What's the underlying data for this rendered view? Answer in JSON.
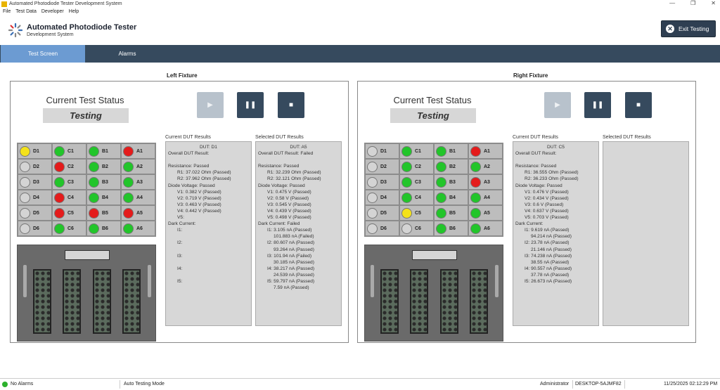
{
  "window": {
    "title": "Automated Photodiode Tester Development System",
    "controls": [
      "—",
      "❐",
      "✕"
    ]
  },
  "menu": [
    "File",
    "Test Data",
    "Developer",
    "Help"
  ],
  "header": {
    "title": "Automated Photodiode Tester",
    "subtitle": "Development System",
    "exit_label": "Exit Testing",
    "exit_icon": "close-circle-icon"
  },
  "tabs": [
    {
      "label": "Test Screen",
      "active": true
    },
    {
      "label": "Alarms",
      "active": false
    }
  ],
  "colors": {
    "green": "#22c52a",
    "red": "#e41b1b",
    "yellow": "#f4e21a",
    "grey": "#d4d4d4",
    "nav": "#364a5e",
    "tab_active": "#6c9bd2"
  },
  "fixtures": [
    {
      "title": "Left Fixture",
      "status_heading": "Current Test Status",
      "status": "Testing",
      "controls": {
        "play": "▶",
        "pause": "❚❚",
        "stop": "■"
      },
      "grid": [
        [
          {
            "label": "D1",
            "state": "yellow"
          },
          {
            "label": "C1",
            "state": "green"
          },
          {
            "label": "B1",
            "state": "green"
          },
          {
            "label": "A1",
            "state": "red"
          }
        ],
        [
          {
            "label": "D2",
            "state": "grey"
          },
          {
            "label": "C2",
            "state": "red"
          },
          {
            "label": "B2",
            "state": "green"
          },
          {
            "label": "A2",
            "state": "green"
          }
        ],
        [
          {
            "label": "D3",
            "state": "grey"
          },
          {
            "label": "C3",
            "state": "green"
          },
          {
            "label": "B3",
            "state": "green"
          },
          {
            "label": "A3",
            "state": "green"
          }
        ],
        [
          {
            "label": "D4",
            "state": "grey"
          },
          {
            "label": "C4",
            "state": "red"
          },
          {
            "label": "B4",
            "state": "green"
          },
          {
            "label": "A4",
            "state": "green"
          }
        ],
        [
          {
            "label": "D5",
            "state": "grey"
          },
          {
            "label": "C5",
            "state": "red"
          },
          {
            "label": "B5",
            "state": "red"
          },
          {
            "label": "A5",
            "state": "red"
          }
        ],
        [
          {
            "label": "D6",
            "state": "grey"
          },
          {
            "label": "C6",
            "state": "green"
          },
          {
            "label": "B6",
            "state": "green"
          },
          {
            "label": "A6",
            "state": "green"
          }
        ]
      ],
      "current_label": "Current DUT Results",
      "current_results": [
        {
          "text": "DUT: D1",
          "style": "c"
        },
        {
          "text": "Overall DUT Result:",
          "style": ""
        },
        {
          "text": "",
          "style": ""
        },
        {
          "text": "Resistance: Passed",
          "style": ""
        },
        {
          "text": "R1: 37.022 Ohm (Passed)",
          "style": "i1"
        },
        {
          "text": "R2: 37.962 Ohm (Passed)",
          "style": "i1"
        },
        {
          "text": "Diode Voltage: Passed",
          "style": ""
        },
        {
          "text": "V1: 0.382 V (Passed)",
          "style": "i1"
        },
        {
          "text": "V2: 0.719 V (Passed)",
          "style": "i1"
        },
        {
          "text": "V3: 0.463 V (Passed)",
          "style": "i1"
        },
        {
          "text": "V4: 0.442 V (Passed)",
          "style": "i1"
        },
        {
          "text": "V5:",
          "style": "i1"
        },
        {
          "text": "Dark Current:",
          "style": ""
        },
        {
          "text": "I1:",
          "style": "i1"
        },
        {
          "text": "",
          "style": ""
        },
        {
          "text": "I2:",
          "style": "i1"
        },
        {
          "text": "",
          "style": ""
        },
        {
          "text": "I3:",
          "style": "i1"
        },
        {
          "text": "",
          "style": ""
        },
        {
          "text": "I4:",
          "style": "i1"
        },
        {
          "text": "",
          "style": ""
        },
        {
          "text": "I5:",
          "style": "i1"
        }
      ],
      "selected_label": "Selected DUT Results",
      "selected_results": [
        {
          "text": "DUT: A5",
          "style": "c"
        },
        {
          "text": "Overall DUT Result: Failed",
          "style": ""
        },
        {
          "text": "",
          "style": ""
        },
        {
          "text": "Resistance: Passed",
          "style": ""
        },
        {
          "text": "R1: 32.239 Ohm (Passed)",
          "style": "i1"
        },
        {
          "text": "R2: 32.121 Ohm (Passed)",
          "style": "i1"
        },
        {
          "text": "Diode Voltage: Passed",
          "style": ""
        },
        {
          "text": "V1: 0.475 V (Passed)",
          "style": "i1"
        },
        {
          "text": "V2: 0.58 V (Passed)",
          "style": "i1"
        },
        {
          "text": "V3: 0.545 V (Passed)",
          "style": "i1"
        },
        {
          "text": "V4: 0.439 V (Passed)",
          "style": "i1"
        },
        {
          "text": "V5: 0.498 V (Passed)",
          "style": "i1"
        },
        {
          "text": "Dark Current: Failed",
          "style": ""
        },
        {
          "text": "I1: 3.105 nA (Passed)",
          "style": "i1"
        },
        {
          "text": "101.883 nA (Failed)",
          "style": "i2"
        },
        {
          "text": "I2: 80.607 nA (Passed)",
          "style": "i1"
        },
        {
          "text": "93.264 nA (Passed)",
          "style": "i2"
        },
        {
          "text": "I3: 101.94 nA (Failed)",
          "style": "i1"
        },
        {
          "text": "30.185 nA (Passed)",
          "style": "i2"
        },
        {
          "text": "I4: 38.217 nA (Passed)",
          "style": "i1"
        },
        {
          "text": "24.539 nA (Passed)",
          "style": "i2"
        },
        {
          "text": "I5: 59.797 nA (Passed)",
          "style": "i1"
        },
        {
          "text": "7.59 nA (Passed)",
          "style": "i2"
        }
      ]
    },
    {
      "title": "Right Fixture",
      "status_heading": "Current Test Status",
      "status": "Testing",
      "controls": {
        "play": "▶",
        "pause": "❚❚",
        "stop": "■"
      },
      "grid": [
        [
          {
            "label": "D1",
            "state": "grey"
          },
          {
            "label": "C1",
            "state": "green"
          },
          {
            "label": "B1",
            "state": "green"
          },
          {
            "label": "A1",
            "state": "red"
          }
        ],
        [
          {
            "label": "D2",
            "state": "grey"
          },
          {
            "label": "C2",
            "state": "green"
          },
          {
            "label": "B2",
            "state": "green"
          },
          {
            "label": "A2",
            "state": "green"
          }
        ],
        [
          {
            "label": "D3",
            "state": "grey"
          },
          {
            "label": "C3",
            "state": "green"
          },
          {
            "label": "B3",
            "state": "green"
          },
          {
            "label": "A3",
            "state": "red"
          }
        ],
        [
          {
            "label": "D4",
            "state": "grey"
          },
          {
            "label": "C4",
            "state": "green"
          },
          {
            "label": "B4",
            "state": "green"
          },
          {
            "label": "A4",
            "state": "green"
          }
        ],
        [
          {
            "label": "D5",
            "state": "grey"
          },
          {
            "label": "C5",
            "state": "yellow"
          },
          {
            "label": "B5",
            "state": "green"
          },
          {
            "label": "A5",
            "state": "green"
          }
        ],
        [
          {
            "label": "D6",
            "state": "grey"
          },
          {
            "label": "C6",
            "state": "grey"
          },
          {
            "label": "B6",
            "state": "green"
          },
          {
            "label": "A6",
            "state": "green"
          }
        ]
      ],
      "current_label": "Current DUT Results",
      "current_results": [
        {
          "text": "DUT: C5",
          "style": "c"
        },
        {
          "text": "Overall DUT Result:",
          "style": ""
        },
        {
          "text": "",
          "style": ""
        },
        {
          "text": "Resistance: Passed",
          "style": ""
        },
        {
          "text": "R1: 36.555 Ohm (Passed)",
          "style": "i1"
        },
        {
          "text": "R2: 36.233 Ohm (Passed)",
          "style": "i1"
        },
        {
          "text": "Diode Voltage: Passed",
          "style": ""
        },
        {
          "text": "V1: 0.476 V (Passed)",
          "style": "i1"
        },
        {
          "text": "V2: 0.434 V (Passed)",
          "style": "i1"
        },
        {
          "text": "V3: 0.6 V (Passed)",
          "style": "i1"
        },
        {
          "text": "V4: 0.637 V (Passed)",
          "style": "i1"
        },
        {
          "text": "V5: 0.703 V (Passed)",
          "style": "i1"
        },
        {
          "text": "Dark Current:",
          "style": ""
        },
        {
          "text": "I1: 9.619 nA (Passed)",
          "style": "i1"
        },
        {
          "text": "94.214 nA (Passed)",
          "style": "i2"
        },
        {
          "text": "I2: 23.78 nA (Passed)",
          "style": "i1"
        },
        {
          "text": "21.146 nA (Passed)",
          "style": "i2"
        },
        {
          "text": "I3: 74.238 nA (Passed)",
          "style": "i1"
        },
        {
          "text": "38.55 nA (Passed)",
          "style": "i2"
        },
        {
          "text": "I4: 90.557 nA (Passed)",
          "style": "i1"
        },
        {
          "text": "37.78 nA (Passed)",
          "style": "i2"
        },
        {
          "text": "I5: 26.673 nA (Passed)",
          "style": "i1"
        }
      ],
      "selected_label": "Selected DUT Results",
      "selected_results": []
    }
  ],
  "statusbar": {
    "alarms": "No Alarms",
    "mode": "Auto Testing Mode",
    "user": "Administrator",
    "host": "DESKTOP-5AJMF82",
    "datetime": "11/25/2025 02:12:29 PM"
  }
}
